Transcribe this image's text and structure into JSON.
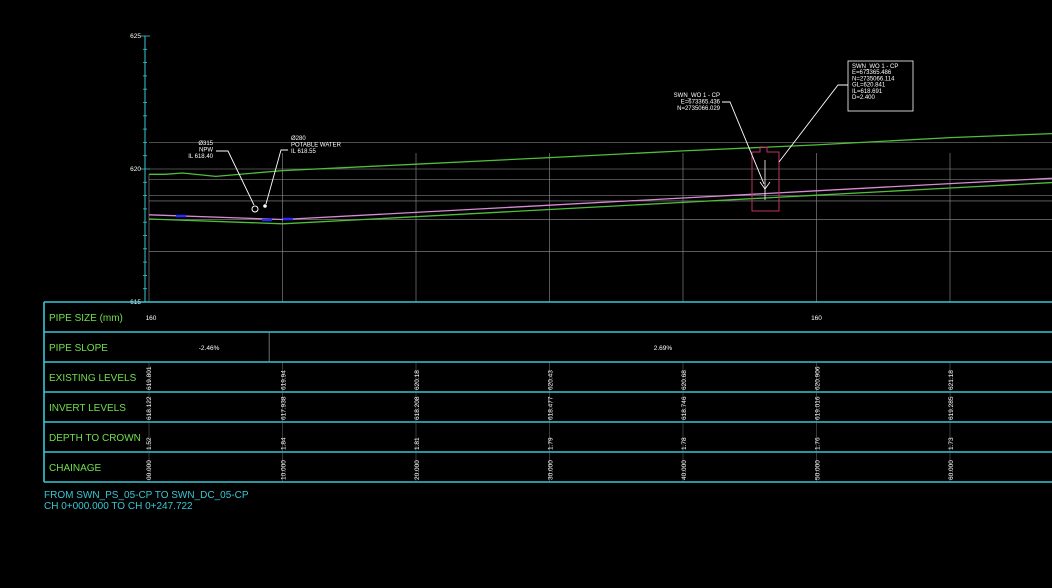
{
  "colors": {
    "background": "#000000",
    "frame": "#39c6d6",
    "grid": "#8a8a8a",
    "ground": "#4fbf3a",
    "pipe_invert": "#4fbf3a",
    "pipe_crown": "#d98ad6",
    "label_text": "#ffffff",
    "row_label": "#6fe04a",
    "manhole": "#c0306a",
    "fitting": "#2a2aff"
  },
  "axis": {
    "ticks": [
      "625",
      "620",
      "615"
    ]
  },
  "chart_data": {
    "type": "line",
    "x_unit_label": "CHAINAGE",
    "y_ticks": [
      625,
      620,
      615
    ],
    "ylim": [
      615,
      625
    ],
    "series": [
      {
        "key": "existing",
        "x": [
          0,
          1.2,
          2.5,
          5,
          10,
          20,
          30,
          40,
          50,
          60,
          68
        ],
        "values": [
          619.8,
          619.8,
          619.85,
          619.72,
          619.94,
          620.18,
          620.43,
          620.68,
          620.906,
          621.18,
          621.34
        ]
      },
      {
        "key": "invert",
        "x": [
          0,
          10,
          20,
          30,
          40,
          50,
          60,
          68
        ],
        "values": [
          618.122,
          617.938,
          618.208,
          618.477,
          618.746,
          619.016,
          619.285,
          619.5
        ]
      },
      {
        "key": "crown",
        "x": [
          0,
          10,
          20,
          30,
          40,
          50,
          60,
          68
        ],
        "values": [
          618.28,
          618.1,
          618.37,
          618.64,
          618.91,
          619.18,
          619.45,
          619.66
        ]
      }
    ],
    "pipe_size": [
      {
        "chainage": 0,
        "label": "160"
      },
      {
        "chainage": 50,
        "label": "160"
      }
    ],
    "pipe_slope": [
      {
        "from": 0,
        "to": 9,
        "label": "-2.46%"
      },
      {
        "from": 9,
        "to": 68,
        "label": "2.69%"
      }
    ],
    "stations": [
      {
        "chainage": 0,
        "existing": "619.801",
        "invert": "618.122",
        "depth": "1.52",
        "chainage_label": "00.000"
      },
      {
        "chainage": 10,
        "existing": "619.94",
        "invert": "617.938",
        "depth": "1.84",
        "chainage_label": "10.000"
      },
      {
        "chainage": 20,
        "existing": "620.18",
        "invert": "618.208",
        "depth": "1.81",
        "chainage_label": "20.000"
      },
      {
        "chainage": 30,
        "existing": "620.43",
        "invert": "618.477",
        "depth": "1.79",
        "chainage_label": "30.000"
      },
      {
        "chainage": 40,
        "existing": "620.68",
        "invert": "618.746",
        "depth": "1.78",
        "chainage_label": "40.000"
      },
      {
        "chainage": 50,
        "existing": "620.906",
        "invert": "619.016",
        "depth": "1.76",
        "chainage_label": "50.000"
      },
      {
        "chainage": 60,
        "existing": "621.18",
        "invert": "619.285",
        "depth": "1.73",
        "chainage_label": "60.000"
      }
    ]
  },
  "table": {
    "rows": [
      "PIPE SIZE (mm)",
      "PIPE SLOPE",
      "EXISTING LEVELS",
      "INVERT LEVELS",
      "DEPTH TO CROWN",
      "CHAINAGE"
    ]
  },
  "annotations": {
    "npw": [
      "Ø315",
      "NPW",
      "IL 618.40"
    ],
    "potable": [
      "Ø280",
      "POTABLE WATER",
      "IL 618.55"
    ],
    "swn_wo_left": [
      "SWN_WO 1 - CP",
      "E=673365.436",
      "N=2735066.029"
    ],
    "swn_wo_box": [
      "SWN_WO 1 - CP",
      "E=673365.486",
      "N=2735066.114",
      "GL=620.841",
      "IL=618.691",
      "D=2.400"
    ]
  },
  "footer": {
    "line1": "FROM SWN_PS_05-CP TO SWN_DC_05-CP",
    "line2": "CH 0+000.000 TO CH 0+247.722"
  }
}
